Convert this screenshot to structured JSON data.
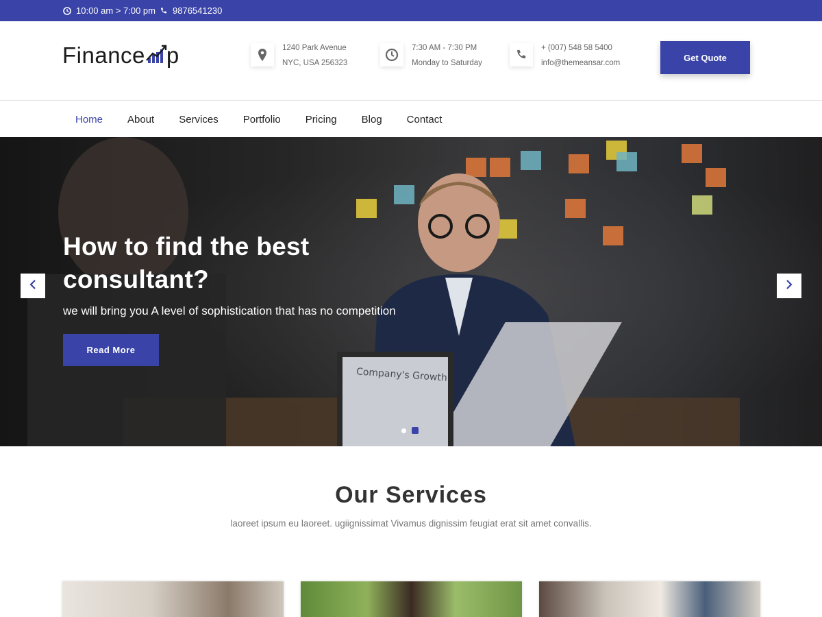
{
  "colors": {
    "brand": "#3a44a8",
    "text_dark": "#1b1b1b",
    "muted": "#777777"
  },
  "topbar": {
    "hours": "10:00 am > 7:00 pm",
    "hours_icon": "clock-icon",
    "phone": "9876541230",
    "phone_icon": "phone-icon"
  },
  "header": {
    "logo_text": "Finance",
    "logo_tail": "p",
    "contact": [
      {
        "icon": "map-marker-icon",
        "line1": "1240 Park Avenue",
        "line2": "NYC, USA 256323"
      },
      {
        "icon": "clock-icon",
        "line1": "7:30 AM - 7:30 PM",
        "line2": "Monday to Saturday"
      },
      {
        "icon": "phone-icon",
        "line1": "+ (007) 548 58 5400",
        "line2": "info@themeansar.com"
      }
    ],
    "cta_label": "Get Quote"
  },
  "nav": {
    "items": [
      "Home",
      "About",
      "Services",
      "Portfolio",
      "Pricing",
      "Blog",
      "Contact"
    ],
    "active": "Home"
  },
  "hero": {
    "title": "How to find the best consultant?",
    "subtitle": "we will bring you A level of sophistication that has no competition",
    "button_label": "Read More",
    "laptop_text": "Company's Growth",
    "prev_icon": "chevron-left-icon",
    "next_icon": "chevron-right-icon",
    "slides_count": 2,
    "active_slide": 2
  },
  "services": {
    "title": "Our Services",
    "subtitle": "laoreet ipsum eu laoreet. ugiignissimat Vivamus dignissim feugiat erat sit amet convallis."
  }
}
